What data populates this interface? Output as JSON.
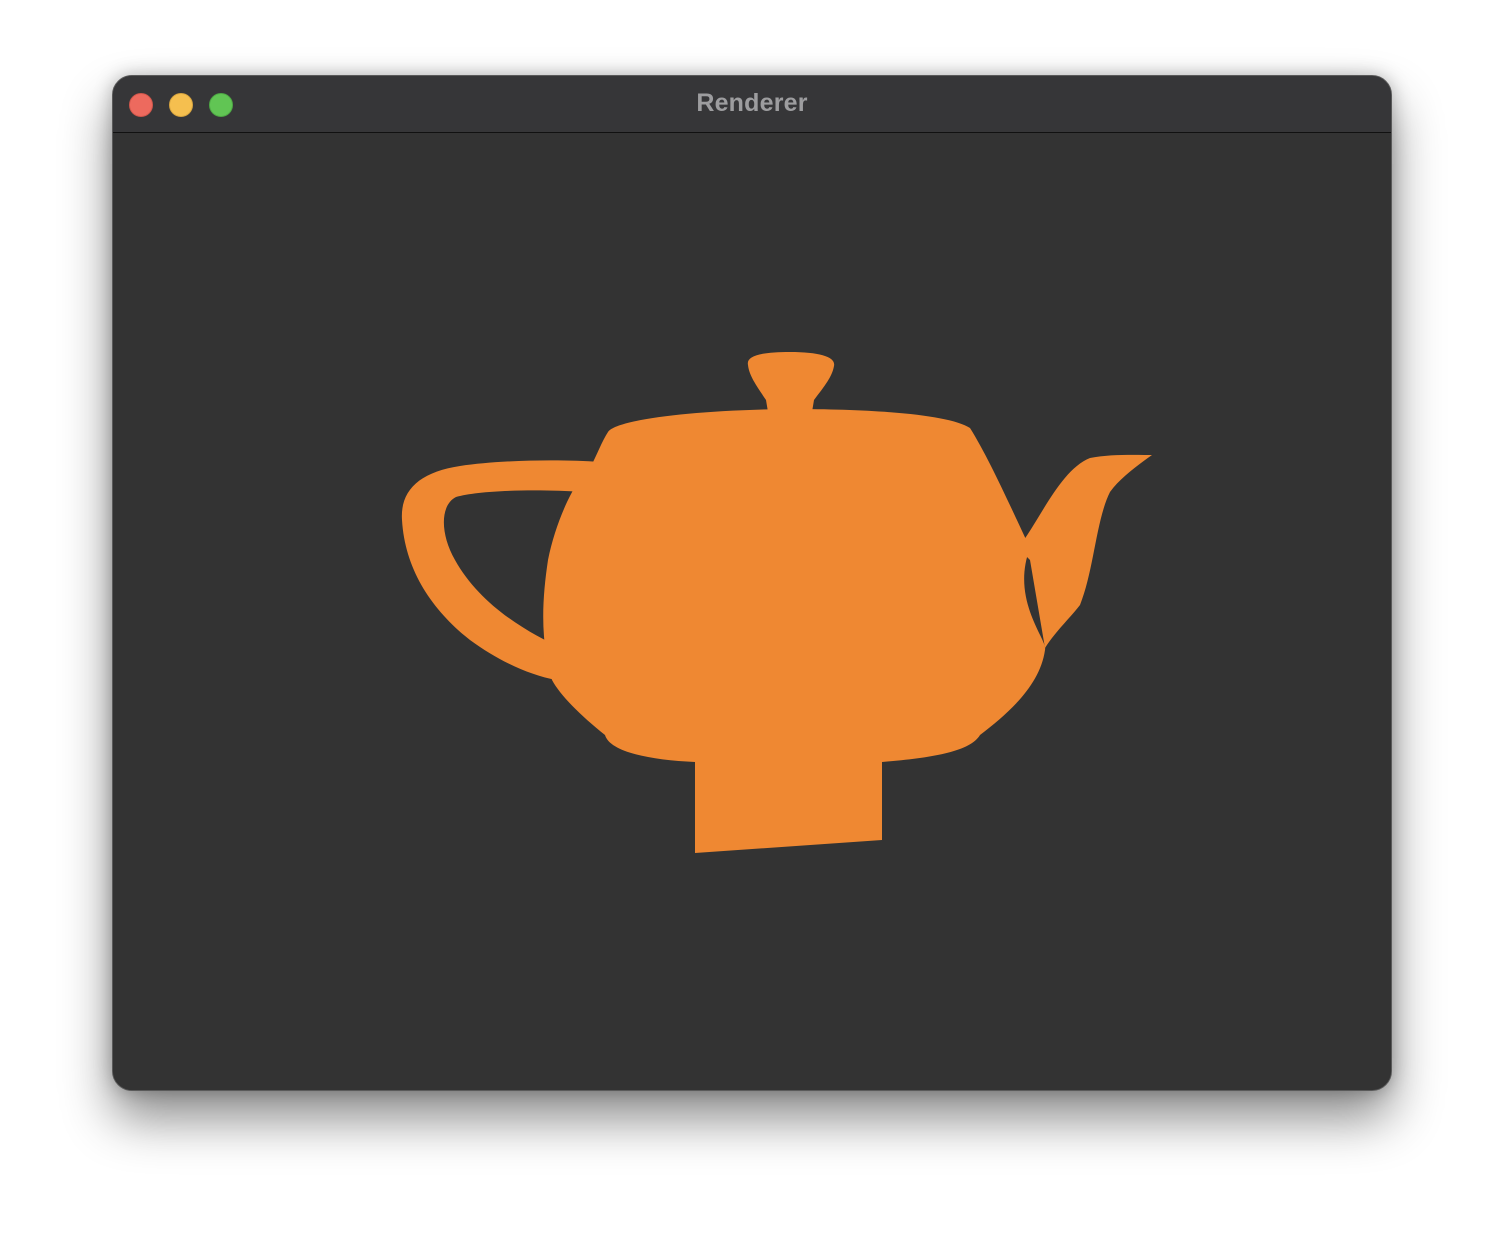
{
  "window": {
    "title": "Renderer",
    "controls": {
      "close": "close",
      "minimize": "minimize",
      "zoom": "zoom"
    }
  },
  "colors": {
    "background": "#333333",
    "titlebar": "#363638",
    "title_text": "#9d9d9f",
    "teapot": "#ef8832",
    "close": "#ed6a5e",
    "minimize": "#f5bf4f",
    "zoom": "#61c554"
  },
  "scene": {
    "object": "teapot"
  }
}
